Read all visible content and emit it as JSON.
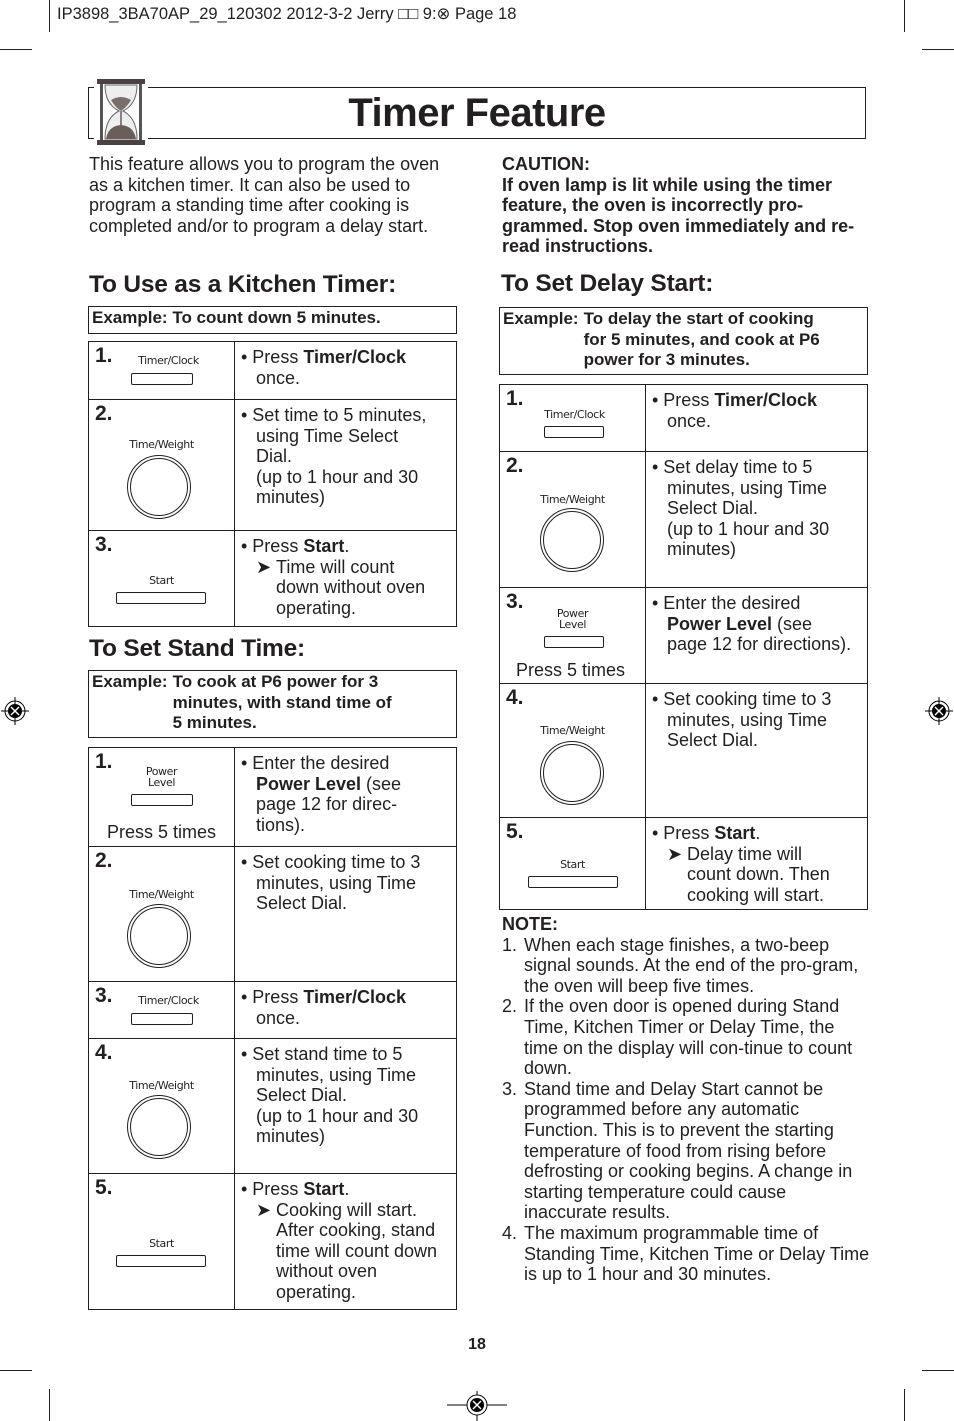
{
  "print_header": "IP3898_3BA70AP_29_120302  2012-3-2  Jerry □□ 9:⊗  Page 18",
  "title": "Timer Feature",
  "intro": "This feature allows you to program the oven as a kitchen timer. It can also be used to program a standing time after cooking is completed and/or to program a delay start.",
  "caution": {
    "heading": "CAUTION:",
    "text": "If oven lamp is lit while using the timer feature, the oven is incorrectly pro-grammed. Stop oven immediately and re-read instructions."
  },
  "buttons": {
    "timer_clock": "Timer/Clock",
    "time_weight": "Time/Weight",
    "start": "Start",
    "power": "Power",
    "level": "Level",
    "press5": "Press 5 times"
  },
  "kitchen_timer": {
    "heading": "To Use  as a Kitchen Timer:",
    "example_label": "Example:",
    "example_text": "To count down 5 minutes.",
    "steps": [
      {
        "num": "1.",
        "pre": "• Press ",
        "bold": "Timer/Clock",
        "post": "",
        "line2": "once."
      },
      {
        "num": "2.",
        "l1": "• Set time to 5 minutes,",
        "l2": "using Time Select",
        "l3": "Dial.",
        "l4": "(up to 1 hour and 30",
        "l5": "minutes)"
      },
      {
        "num": "3.",
        "pre": "• Press ",
        "bold": "Start",
        "post": ".",
        "arrow": "➤",
        "a1": "Time will count",
        "a2": "down without oven",
        "a3": "operating."
      }
    ]
  },
  "stand_time": {
    "heading": "To Set Stand Time:",
    "example_label": "Example:",
    "example_l1": "To cook at P6 power for 3",
    "example_l2": "minutes, with stand time of",
    "example_l3": "5 minutes.",
    "steps": [
      {
        "num": "1.",
        "l1": "• Enter the desired",
        "bold": "Power Level",
        "post": " (see",
        "l3": "page 12 for direc-",
        "l4": "tions)."
      },
      {
        "num": "2.",
        "l1": "• Set cooking time to 3",
        "l2": "minutes, using Time",
        "l3": "Select Dial."
      },
      {
        "num": "3.",
        "pre": "• Press ",
        "bold": "Timer/Clock",
        "line2": "once."
      },
      {
        "num": "4.",
        "l1": "• Set stand time to 5",
        "l2": "minutes, using Time",
        "l3": "Select Dial.",
        "l4": "(up to 1 hour and 30",
        "l5": "minutes)"
      },
      {
        "num": "5.",
        "pre": "• Press ",
        "bold": "Start",
        "post": ".",
        "arrow": "➤",
        "a1": "Cooking will start.",
        "a2": "After cooking, stand",
        "a3": "time will count down",
        "a4": "without oven",
        "a5": "operating."
      }
    ]
  },
  "delay_start": {
    "heading": "To Set Delay Start:",
    "example_label": "Example:",
    "example_l1": "To delay the start of cooking",
    "example_l2": "for 5 minutes, and cook at P6",
    "example_l3": "power for 3 minutes.",
    "steps": [
      {
        "num": "1.",
        "pre": "• Press ",
        "bold": "Timer/Clock",
        "line2": "once."
      },
      {
        "num": "2.",
        "l1": "• Set delay time to 5",
        "l2": "minutes, using Time",
        "l3": "Select Dial.",
        "l4": "(up to 1 hour and 30",
        "l5": "minutes)"
      },
      {
        "num": "3.",
        "l1": "• Enter the desired",
        "bold": "Power Level",
        "post": " (see",
        "l3": "page 12 for directions)."
      },
      {
        "num": "4.",
        "l1": "• Set cooking time to 3",
        "l2": "minutes, using Time",
        "l3": "Select Dial."
      },
      {
        "num": "5.",
        "pre": "• Press ",
        "bold": "Start",
        "post": ".",
        "arrow": "➤",
        "a1": "Delay time will",
        "a2": "count down. Then",
        "a3": "cooking will start."
      }
    ]
  },
  "notes": {
    "heading": "NOTE:",
    "items": [
      {
        "num": "1.",
        "text": "When each stage finishes, a two-beep signal sounds. At the end of the pro-gram, the oven will beep five times."
      },
      {
        "num": "2.",
        "text": "If the oven door is opened during Stand Time, Kitchen Timer or Delay Time, the time on the display will con-tinue to count down."
      },
      {
        "num": "3.",
        "text": "Stand time and Delay Start cannot be programmed before any automatic Function. This is to prevent the starting temperature of food from rising before defrosting or cooking begins. A change in starting temperature could cause inaccurate results."
      },
      {
        "num": "4.",
        "text": "The maximum programmable time of Standing Time, Kitchen Time or Delay Time is up to 1 hour and 30 minutes."
      }
    ]
  },
  "page_number": "18"
}
